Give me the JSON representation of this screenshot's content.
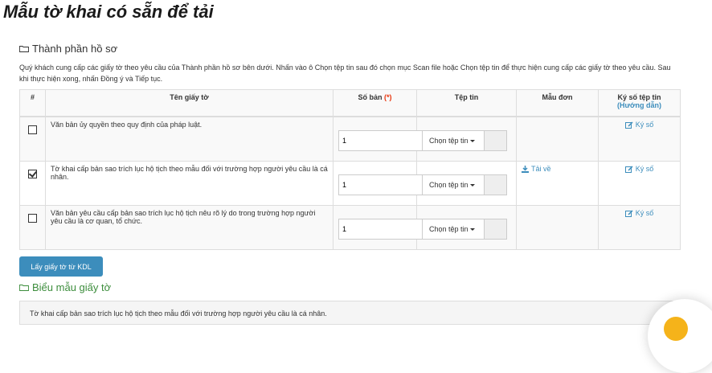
{
  "page_title": "Mẫu tờ khai có sẵn để tải",
  "components_section": {
    "title": "Thành phần hồ sơ",
    "description": "Quý khách cung cấp các giấy tờ theo yêu cầu của Thành phần hồ sơ bên dưới. Nhấn vào ô Chọn tệp tin sau đó chọn mục Scan file hoặc Chọn tệp tin để thực hiện cung cấp các giấy tờ theo yêu cầu. Sau khi thực hiện xong, nhấn Đồng ý và Tiếp tục."
  },
  "table": {
    "headers": {
      "index": "#",
      "name": "Tên giấy tờ",
      "copies": "Số bản",
      "copies_required": "(*)",
      "file": "Tệp tin",
      "template": "Mẫu đơn",
      "sign": "Ký số tệp tin",
      "sign_guide": "(Hướng dẫn)"
    },
    "rows": [
      {
        "checked": false,
        "name": "Văn bản ủy quyền theo quy định của pháp luật.",
        "copies": "1",
        "file_button": "Chọn tệp tin",
        "template_link": "",
        "sign_link": "Ký số"
      },
      {
        "checked": true,
        "name": "Tờ khai cấp bản sao trích lục hộ tịch theo mẫu đối với trường hợp người yêu cầu là cá nhân.",
        "copies": "1",
        "file_button": "Chọn tệp tin",
        "template_link": "Tải về",
        "sign_link": "Ký số"
      },
      {
        "checked": false,
        "name": "Văn bản yêu cầu cấp bản sao trích lục hộ tịch nêu rõ lý do trong trường hợp người yêu cầu là cơ quan, tổ chức.",
        "copies": "1",
        "file_button": "Chọn tệp tin",
        "template_link": "",
        "sign_link": "Ký số"
      }
    ]
  },
  "kdl_button": "Lấy giấy tờ từ KDL",
  "form_section": {
    "title": "Biểu mẫu giấy tờ",
    "item": "Tờ khai cấp bản sao trích lục hộ tịch theo mẫu đối với trường hợp người yêu cầu là cá nhân."
  },
  "colors": {
    "primary": "#3c8dbc",
    "section_green": "#3c8d3c",
    "required_red": "#e8340c",
    "floating_button": "#f5b31a"
  },
  "icons": {
    "folder": "folder-open-icon",
    "download": "download-icon",
    "edit": "edit-icon",
    "caret": "caret-down-icon"
  }
}
